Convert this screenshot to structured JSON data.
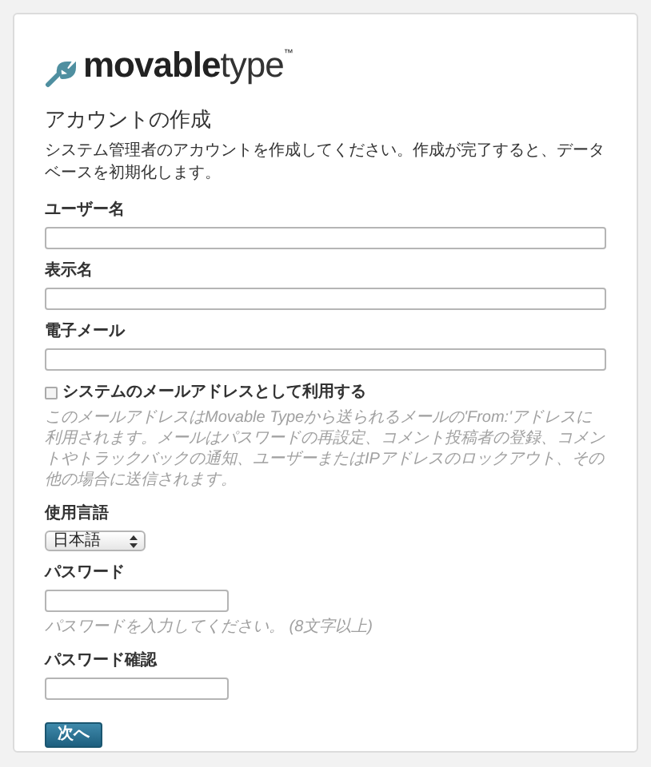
{
  "logo": {
    "bold": "movable",
    "light": "type",
    "mark": "™"
  },
  "title": "アカウントの作成",
  "intro": "システム管理者のアカウントを作成してください。作成が完了すると、データベースを初期化します。",
  "fields": [
    {
      "kind": "text",
      "label": "ユーザー名"
    },
    {
      "kind": "text",
      "label": "表示名"
    },
    {
      "kind": "text",
      "label": "電子メール"
    },
    {
      "kind": "checkbox",
      "label": "システムのメールアドレスとして利用する",
      "checked": false,
      "hint": "このメールアドレスはMovable Typeから送られるメールの'From:'アドレスに利用されます。メールはパスワードの再設定、コメント投稿者の登録、コメントやトラックバックの通知、ユーザーまたはIPアドレスのロックアウト、その他の場合に送信されます。"
    },
    {
      "kind": "select",
      "label": "使用言語",
      "value": "日本語"
    },
    {
      "kind": "short",
      "label": "パスワード",
      "hint": "パスワードを入力してください。 (8文字以上)"
    },
    {
      "kind": "short",
      "label": "パスワード確認"
    }
  ],
  "button": "次へ"
}
